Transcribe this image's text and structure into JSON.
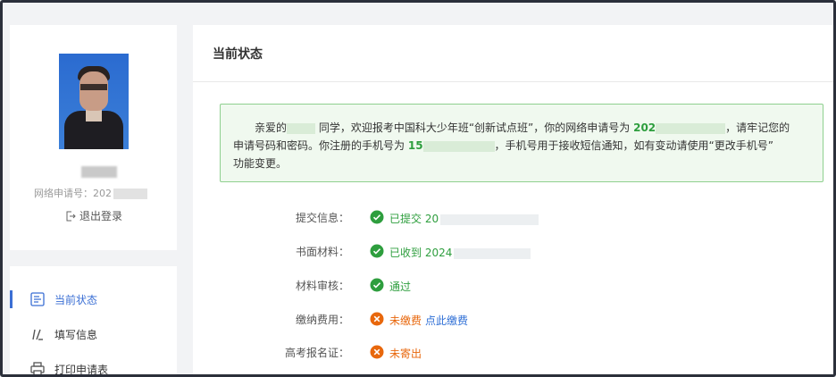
{
  "profile": {
    "greeting_tag": "",
    "app_no_label": "网络申请号：202",
    "logout_label": "退出登录"
  },
  "menu": {
    "items": [
      {
        "label": "当前状态",
        "active": true
      },
      {
        "label": "填写信息",
        "active": false
      },
      {
        "label": "打印申请表",
        "active": false
      }
    ]
  },
  "main": {
    "title": "当前状态",
    "notice": {
      "line1_a": "亲爱的",
      "line1_b": "同学，欢迎报考中国科大少年班“创新试点班”，你的网络申请号为",
      "app_no_prefix": "202",
      "line1_c": "，请牢记您的",
      "line2_a": "申请号码和密码。你注册的手机号为",
      "phone_prefix": "15",
      "line2_b": "，手机号用于接收短信通知，如有变动请使用“更改手机号”",
      "line3": "功能变更。"
    },
    "status": [
      {
        "key": "提交信息：",
        "state": "ok",
        "value": "已提交 20"
      },
      {
        "key": "书面材料：",
        "state": "ok",
        "value": "已收到 2024"
      },
      {
        "key": "材料审核：",
        "state": "ok",
        "value": "通过"
      },
      {
        "key": "缴纳费用：",
        "state": "bad",
        "value": "未缴费",
        "link": "点此缴费"
      },
      {
        "key": "高考报名证：",
        "state": "bad",
        "value": "未寄出"
      }
    ]
  },
  "colors": {
    "accent": "#3b6fd4",
    "ok": "#2e9e3e",
    "bad": "#e8670c",
    "link": "#2f6fd6"
  }
}
